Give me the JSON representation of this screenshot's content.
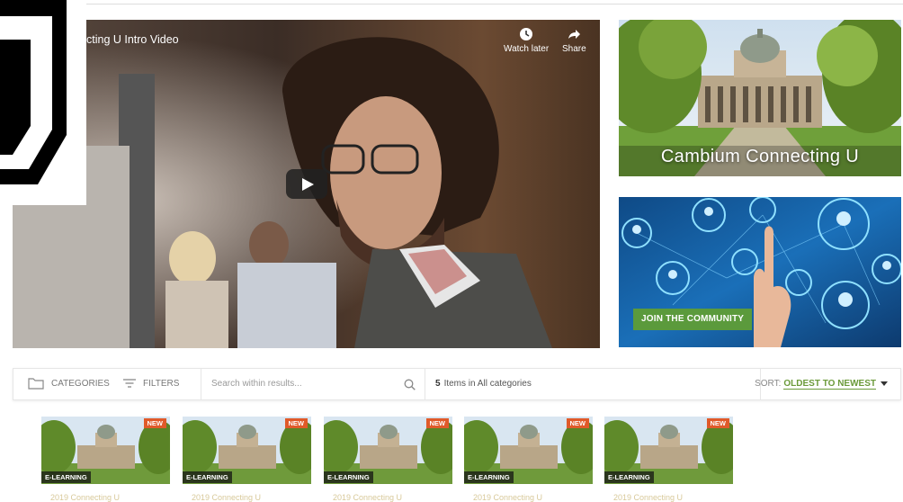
{
  "video": {
    "title": "cting U Intro Video",
    "watch_later_label": "Watch later",
    "share_label": "Share"
  },
  "panels": {
    "campus_caption": "Cambium Connecting U",
    "join_label": "JOIN THE COMMUNITY"
  },
  "toolbar": {
    "categories_label": "CATEGORIES",
    "filters_label": "FILTERS",
    "search_placeholder": "Search within results...",
    "count_number": "5",
    "count_text": "Items in All categories",
    "sort_label": "SORT:",
    "sort_value": "OLDEST TO NEWEST"
  },
  "cards": [
    {
      "badge": "NEW",
      "type": "E-LEARNING",
      "title": "2019 Connecting U"
    },
    {
      "badge": "NEW",
      "type": "E-LEARNING",
      "title": "2019 Connecting U"
    },
    {
      "badge": "NEW",
      "type": "E-LEARNING",
      "title": "2019 Connecting U"
    },
    {
      "badge": "NEW",
      "type": "E-LEARNING",
      "title": "2019 Connecting U"
    },
    {
      "badge": "NEW",
      "type": "E-LEARNING",
      "title": "2019 Connecting U"
    }
  ],
  "colors": {
    "accent_green": "#6b9a3a",
    "join_button": "#5b9a3c",
    "new_badge": "#e05a2a"
  }
}
